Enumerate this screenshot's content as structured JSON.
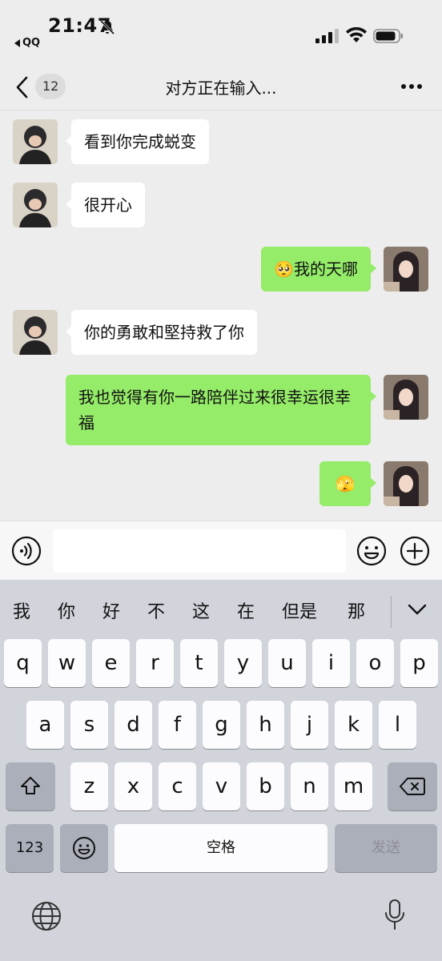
{
  "status_bar": {
    "time": "21:47",
    "back_app": "QQ"
  },
  "nav": {
    "unread_count": "12",
    "title": "对方正在输入..."
  },
  "messages": [
    {
      "side": "left",
      "text": "看到你完成蜕变"
    },
    {
      "side": "left",
      "text": "很开心"
    },
    {
      "side": "right",
      "emoji": "🥺",
      "text": "我的天哪"
    },
    {
      "side": "left",
      "text": "你的勇敢和堅持救了你"
    },
    {
      "side": "right",
      "text": "我也觉得有你一路陪伴过来很幸运很幸福"
    },
    {
      "side": "right",
      "emoji": "🫣",
      "text": ""
    }
  ],
  "keyboard": {
    "candidates": [
      "我",
      "你",
      "好",
      "不",
      "这",
      "在",
      "但是",
      "那"
    ],
    "row1": [
      "q",
      "w",
      "e",
      "r",
      "t",
      "y",
      "u",
      "i",
      "o",
      "p"
    ],
    "row2": [
      "a",
      "s",
      "d",
      "f",
      "g",
      "h",
      "j",
      "k",
      "l"
    ],
    "row3": [
      "z",
      "x",
      "c",
      "v",
      "b",
      "n",
      "m"
    ],
    "numbers_label": "123",
    "space_label": "空格",
    "send_label": "发送"
  },
  "colors": {
    "background": "#ededed",
    "sent_bubble": "#95ec69",
    "received_bubble": "#ffffff",
    "keyboard_bg": "#d1d4db"
  }
}
